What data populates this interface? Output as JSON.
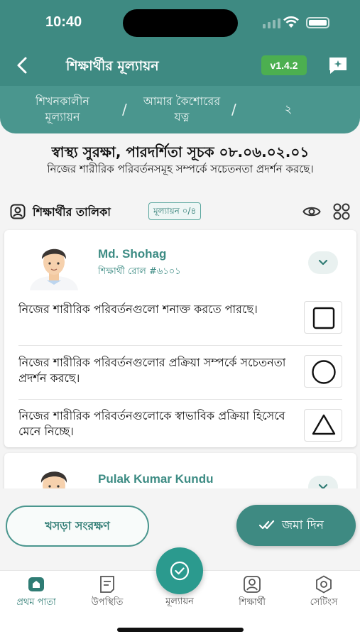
{
  "status_bar": {
    "time": "10:40"
  },
  "header": {
    "title": "শিক্ষার্থীর মূল্যায়ন",
    "version": "v1.4.2",
    "breadcrumb": [
      "শিখনকালীন মূল্যায়ন",
      "আমার কৈশোরের যত্ন",
      "২"
    ]
  },
  "section": {
    "title": "স্বাস্থ্য সুরক্ষা, পারদর্শিতা সূচক ০৮.০৬.০২.০১",
    "subtitle": "নিজের শারীরিক পরিবর্তনসমূহ সম্পর্কে সচেতনতা প্রদর্শন করছে।"
  },
  "student_list": {
    "label": "শিক্ষার্থীর তালিকা",
    "badge": "মূল্যায়ন ০/৪"
  },
  "students": [
    {
      "name": "Md. Shohag",
      "roll": "শিক্ষার্থী রোল #৬১০১",
      "criteria": [
        {
          "text": "নিজের শারীরিক পরিবর্তনগুলো শনাক্ত করতে পারছে।",
          "shape": "square"
        },
        {
          "text": "নিজের শারীরিক পরিবর্তনগুলোর প্রক্রিয়া সম্পর্কে সচেতনতা প্রদর্শন করছে।",
          "shape": "circle"
        },
        {
          "text": "নিজের শারীরিক পরিবর্তনগুলোকে স্বাভাবিক প্রক্রিয়া হিসেবে মেনে নিচ্ছে।",
          "shape": "triangle"
        }
      ]
    },
    {
      "name": "Pulak Kumar Kundu"
    }
  ],
  "actions": {
    "draft": "খসড়া সংরক্ষণ",
    "submit": "জমা দিন"
  },
  "tabs": [
    "প্রথম পাতা",
    "উপস্থিতি",
    "মূল্যায়ন",
    "শিক্ষার্থী",
    "সেটিংস"
  ],
  "colors": {
    "primary": "#3e8a82",
    "accent": "#2b9a8e",
    "version_badge": "#4caf50"
  }
}
